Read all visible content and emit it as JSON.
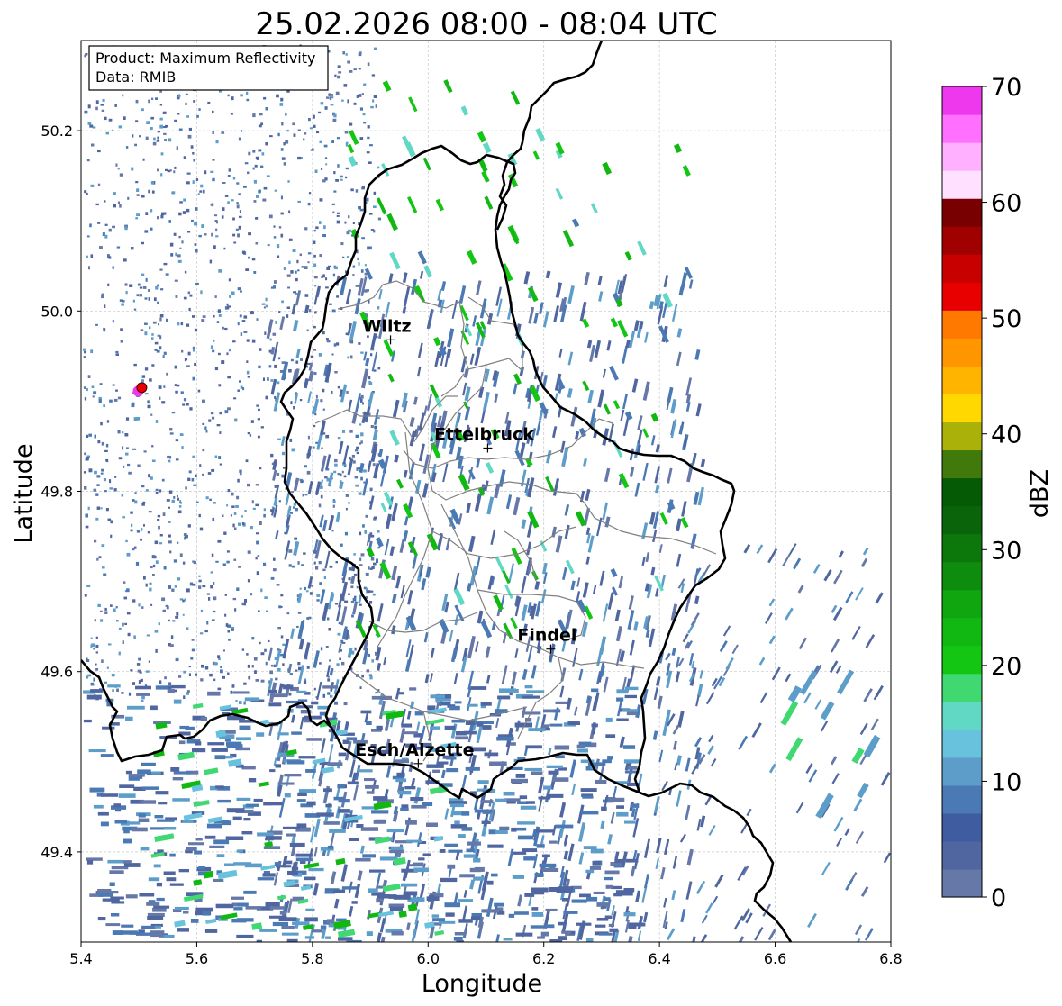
{
  "title": "25.02.2026 08:00 - 08:04 UTC",
  "info_box": {
    "product": "Product: Maximum Reflectivity",
    "source": "Data: RMIB"
  },
  "axes": {
    "xlabel": "Longitude",
    "ylabel": "Latitude",
    "x_range": [
      5.4,
      6.8
    ],
    "y_range": [
      49.3,
      50.3
    ],
    "x_ticks": [
      5.4,
      5.6,
      5.8,
      6.0,
      6.2,
      6.4,
      6.6,
      6.8
    ],
    "x_tick_labels": [
      "5.4",
      "5.6",
      "5.8",
      "6.0",
      "6.2",
      "6.4",
      "6.6",
      "6.8"
    ],
    "y_ticks": [
      49.4,
      49.6,
      49.8,
      50.0,
      50.2
    ],
    "y_tick_labels": [
      "49.4",
      "49.6",
      "49.8",
      "50.0",
      "50.2"
    ],
    "grid": true
  },
  "colorbar": {
    "label": "dBZ",
    "range": [
      0,
      70
    ],
    "tick_values": [
      0,
      10,
      20,
      30,
      40,
      50,
      60,
      70
    ],
    "tick_labels": [
      "0",
      "10",
      "20",
      "30",
      "40",
      "50",
      "60",
      "70"
    ],
    "colors": [
      "#6578a8",
      "#4f66a0",
      "#3f5ca1",
      "#4b79b4",
      "#5c9ec9",
      "#68c2de",
      "#60d8c4",
      "#40d870",
      "#14c614",
      "#12b812",
      "#10a610",
      "#0e8c0e",
      "#0c780c",
      "#0a640a",
      "#055a05",
      "#417a0a",
      "#aab20a",
      "#ffd800",
      "#ffb400",
      "#ff9600",
      "#ff7800",
      "#e80000",
      "#c80000",
      "#a00000",
      "#780000",
      "#ffe0ff",
      "#ffb0ff",
      "#ff70ff",
      "#ee38ee"
    ]
  },
  "places": [
    {
      "name": "Wiltz",
      "lon": 5.935,
      "lat": 49.968
    },
    {
      "name": "Ettelbruck",
      "lon": 6.103,
      "lat": 49.848
    },
    {
      "name": "Findel",
      "lon": 6.212,
      "lat": 49.625
    },
    {
      "name": "Esch/Alzette",
      "lon": 5.983,
      "lat": 49.498
    }
  ],
  "radar_marker": {
    "lon": 5.505,
    "lat": 49.915
  }
}
